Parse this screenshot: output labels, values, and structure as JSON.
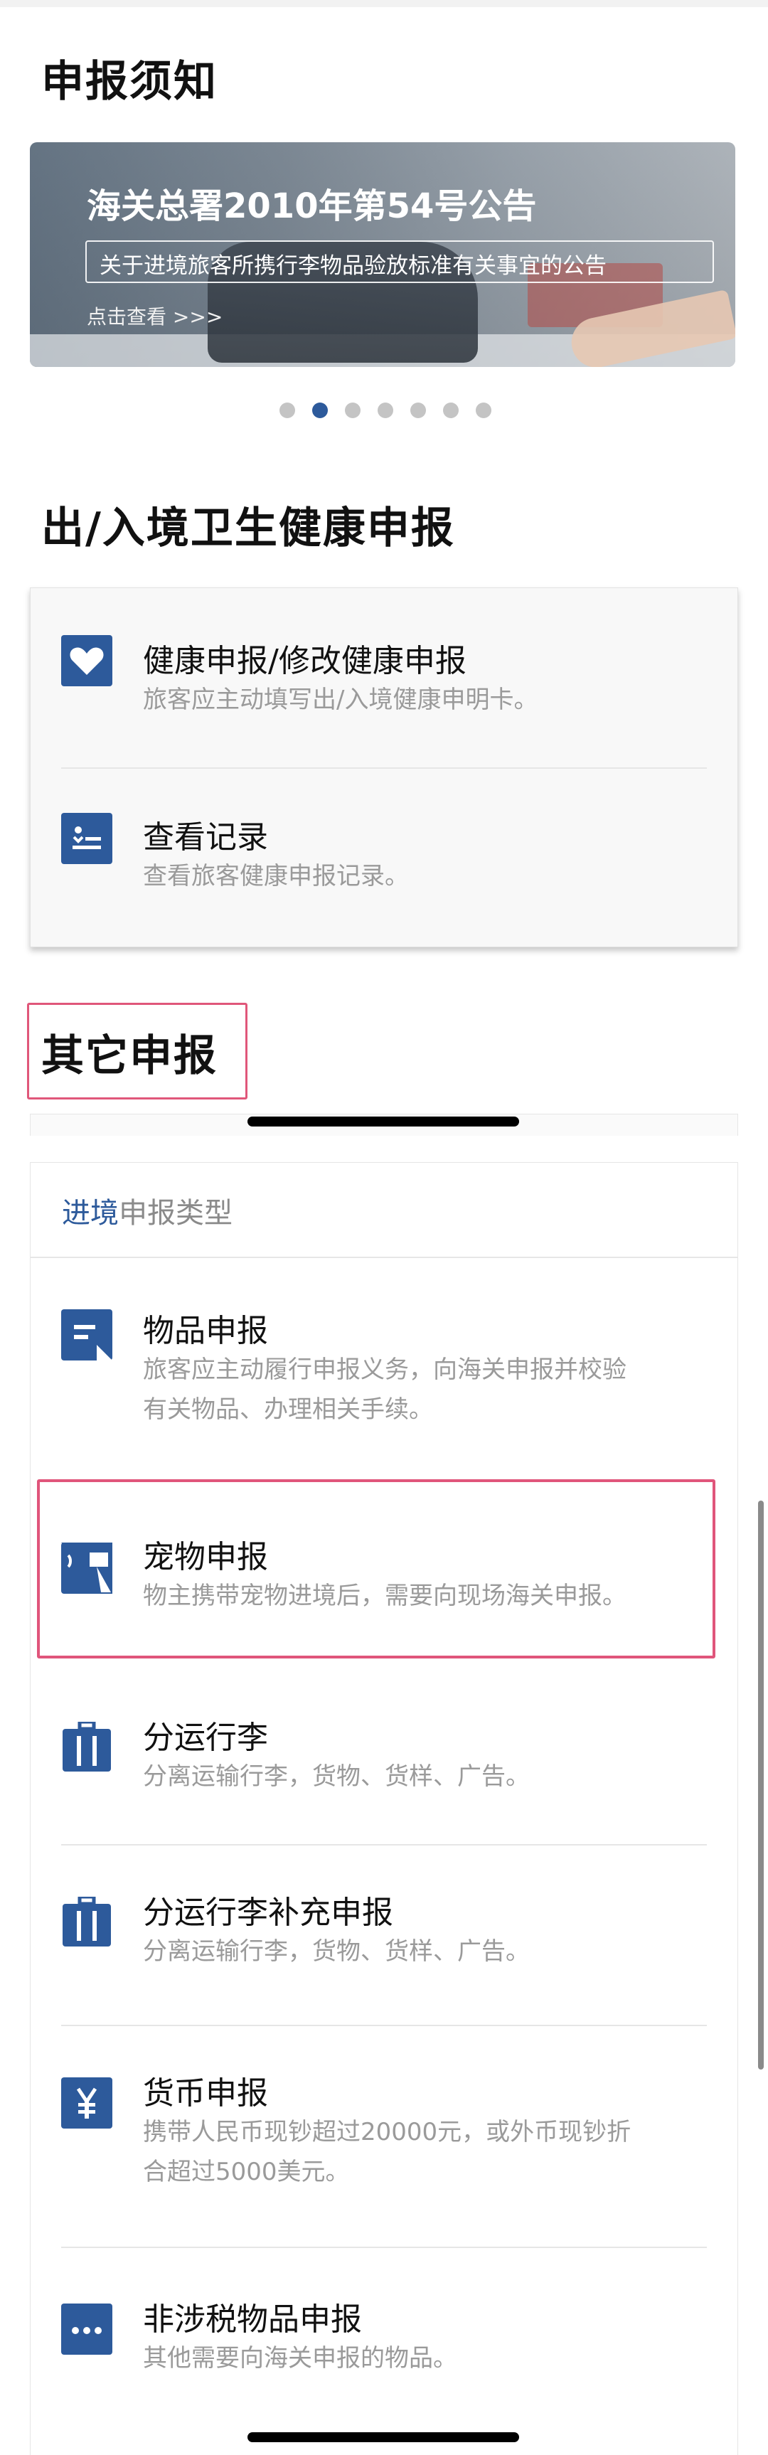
{
  "notice": {
    "title": "申报须知",
    "banner": {
      "headline": "海关总署2010年第54号公告",
      "subline": "关于进境旅客所携行李物品验放标准有关事宜的公告",
      "link": "点击查看 >>>"
    },
    "carousel": {
      "total": 7,
      "active_index": 1
    }
  },
  "health": {
    "title": "出/入境卫生健康申报",
    "items": [
      {
        "title": "健康申报/修改健康申报",
        "desc": "旅客应主动填写出/入境健康申明卡。",
        "icon": "heart-icon"
      },
      {
        "title": "查看记录",
        "desc": "查看旅客健康申报记录。",
        "icon": "record-list-icon"
      }
    ]
  },
  "other": {
    "title": "其它申报",
    "type_label_prefix": "进境",
    "type_label_suffix": "申报类型",
    "items": [
      {
        "title": "物品申报",
        "desc1": "旅客应主动履行申报义务，向海关申报并校验",
        "desc2": "有关物品、办理相关手续。",
        "icon": "document-icon"
      },
      {
        "title": "宠物申报",
        "desc1": "物主携带宠物进境后，需要向现场海关申报。",
        "icon": "pet-icon"
      },
      {
        "title": "分运行李",
        "desc1": "分离运输行李，货物、货样、广告。",
        "icon": "luggage-icon"
      },
      {
        "title": "分运行李补充申报",
        "desc1": "分离运输行李，货物、货样、广告。",
        "icon": "luggage-icon"
      },
      {
        "title": "货币申报",
        "desc1": "携带人民币现钞超过20000元，或外币现钞折",
        "desc2": "合超过5000美元。",
        "icon": "yen-icon"
      },
      {
        "title": "非涉税物品申报",
        "desc1": "其他需要向海关申报的物品。",
        "icon": "more-icon"
      }
    ]
  },
  "colors": {
    "accent": "#2d5a9b",
    "highlight": "#e0577a"
  }
}
